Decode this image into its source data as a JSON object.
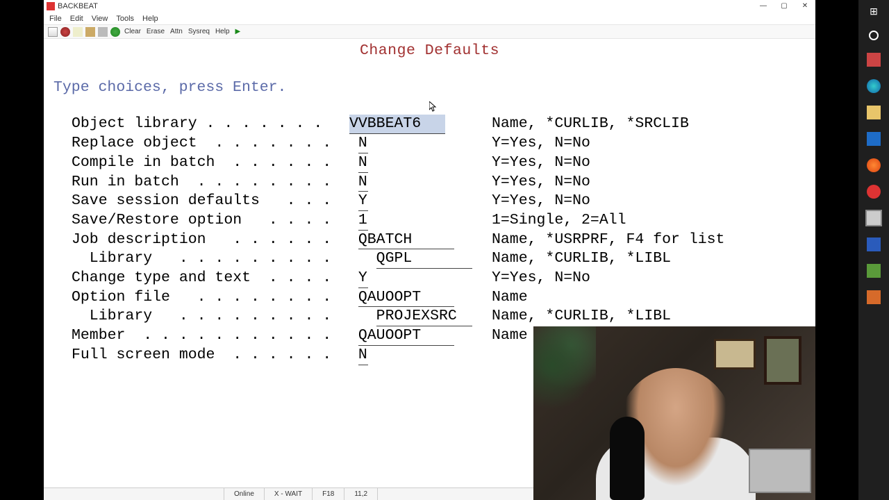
{
  "window": {
    "title": "BACKBEAT"
  },
  "menu": {
    "file": "File",
    "edit": "Edit",
    "view": "View",
    "tools": "Tools",
    "help": "Help"
  },
  "toolbar": {
    "clear": "Clear",
    "erase": "Erase",
    "attn": "Attn",
    "sysreq": "Sysreq",
    "help": "Help"
  },
  "screen": {
    "title": "Change Defaults",
    "prompt": "Type choices, press Enter."
  },
  "rows": [
    {
      "label": "Object library . . . . . . .   ",
      "value": "VVBBEAT6",
      "vwidth": "138px",
      "sel": true,
      "hint": "Name, *CURLIB, *SRCLIB"
    },
    {
      "label": "Replace object  . . . . . . .   ",
      "value": "N",
      "vwidth": "14px",
      "hint": "Y=Yes, N=No"
    },
    {
      "label": "Compile in batch  . . . . . .   ",
      "value": "N",
      "vwidth": "14px",
      "hint": "Y=Yes, N=No"
    },
    {
      "label": "Run in batch  . . . . . . . .   ",
      "value": "N",
      "vwidth": "14px",
      "hint": "Y=Yes, N=No"
    },
    {
      "label": "Save session defaults   . . .   ",
      "value": "Y",
      "vwidth": "14px",
      "hint": "Y=Yes, N=No"
    },
    {
      "label": "Save/Restore option   . . . .   ",
      "value": "1",
      "vwidth": "14px",
      "hint": "1=Single, 2=All"
    },
    {
      "label": "Job description   . . . . . .   ",
      "value": "QBATCH",
      "vwidth": "138px",
      "hint": "Name, *USRPRF, F4 for list"
    },
    {
      "label": "  Library   . . . . . . . . .     ",
      "value": "QGPL",
      "vwidth": "138px",
      "hint": "Name, *CURLIB, *LIBL"
    },
    {
      "label": "Change type and text  . . . .   ",
      "value": "Y",
      "vwidth": "14px",
      "hint": "Y=Yes, N=No"
    },
    {
      "label": "Option file   . . . . . . . .   ",
      "value": "QAUOOPT",
      "vwidth": "138px",
      "hint": "Name"
    },
    {
      "label": "  Library   . . . . . . . . .     ",
      "value": "PROJEXSRC",
      "vwidth": "138px",
      "hint": "Name, *CURLIB, *LIBL"
    },
    {
      "label": "Member  . . . . . . . . . . .   ",
      "value": "QAUOOPT",
      "vwidth": "138px",
      "hint": "Name"
    },
    {
      "label": "Full screen mode  . . . . . .   ",
      "value": "N",
      "vwidth": "14px",
      "hint": ""
    }
  ],
  "status": {
    "online": "Online",
    "wait": "X - WAIT",
    "fkey": "F18",
    "pos": "11,2"
  }
}
